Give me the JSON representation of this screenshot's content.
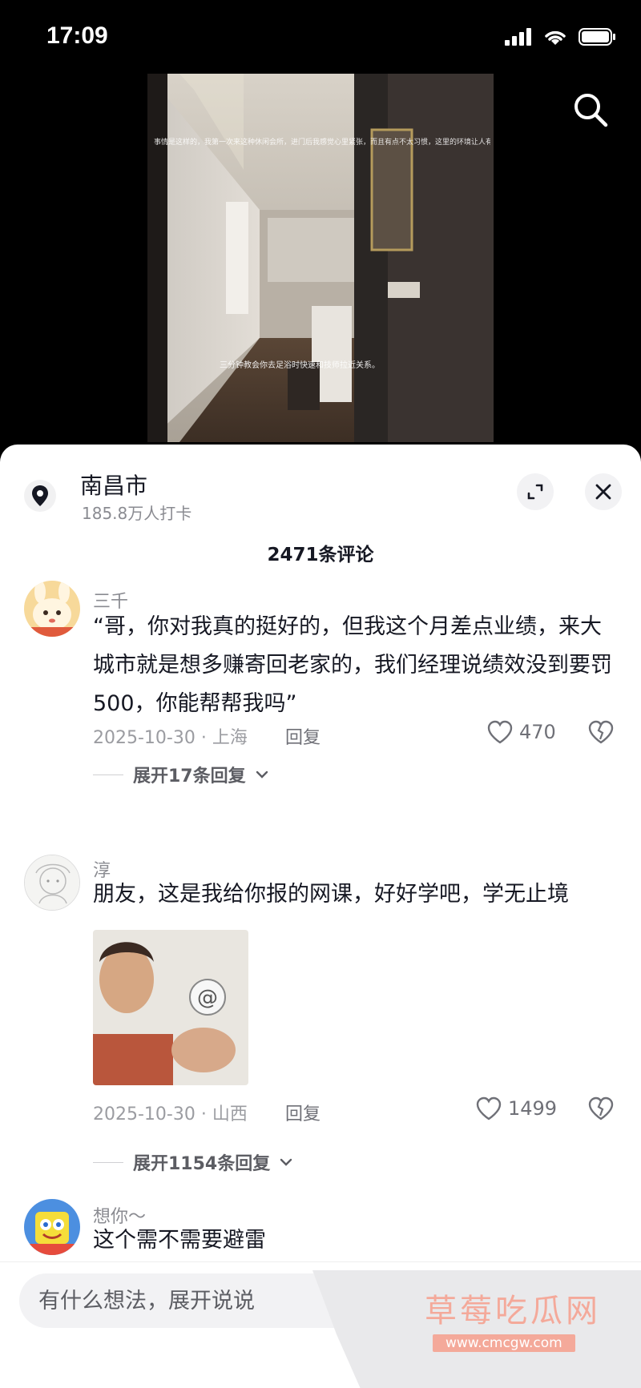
{
  "status_bar": {
    "time": "17:09"
  },
  "video": {
    "overlay_top": "事情是这样的，我第一次来这种休闲会所，进门后我感觉心里紧张，而且有点不太习惯，这里的环境让人有些拘束",
    "overlay_middle": "三分钟教会你去足浴时快速和技师拉近关系。"
  },
  "location": {
    "name": "南昌市",
    "subtitle": "185.8万人打卡"
  },
  "comment_count": "2471条评论",
  "comments": [
    {
      "user": "三千",
      "text": "“哥，你对我真的挺好的，但我这个月差点业绩，来大城市就是想多赚寄回老家的，我们经理说绩效没到要罚500，你能帮帮我吗”",
      "date_loc": "2025-10-30 · 上海",
      "reply": "回复",
      "likes": "470",
      "expand": "展开17条回复"
    },
    {
      "user": "淳",
      "text": "朋友，这是我给你报的网课，好好学吧，学无止境",
      "date_loc": "2025-10-30 · 山西",
      "reply": "回复",
      "likes": "1499",
      "expand": "展开1154条回复"
    },
    {
      "user": "想你～",
      "text": "这个需不需要避雷"
    }
  ],
  "input": {
    "placeholder": "有什么想法，展开说说"
  },
  "watermark": {
    "title": "草莓吃瓜网",
    "url": "www.cmcgw.com"
  },
  "colors": {
    "accent_watermark": "#f4a99a",
    "sheet_bg": "#ffffff",
    "text_primary": "#161823",
    "text_secondary": "#8a8b91"
  }
}
